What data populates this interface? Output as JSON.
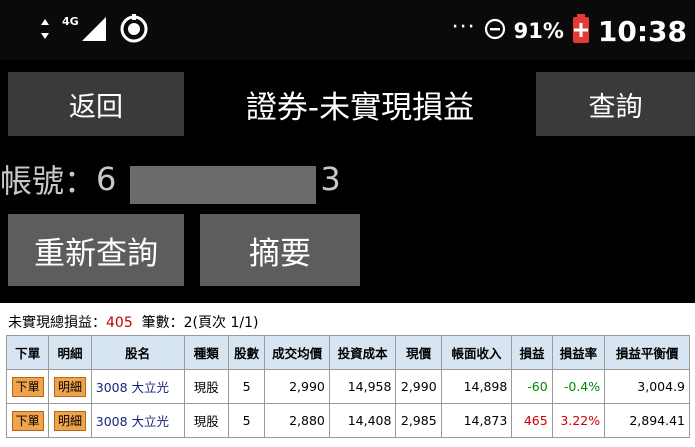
{
  "status_bar": {
    "network": "4G",
    "battery_percent": "91%",
    "time": "10:38",
    "dots": "···",
    "icons": [
      "data-arrows-icon",
      "signal-icon",
      "location-icon",
      "dnd-icon",
      "battery-icon"
    ]
  },
  "header": {
    "back_label": "返回",
    "title": "證券-未實現損益",
    "query_label": "查詢"
  },
  "account": {
    "label": "帳號：",
    "value_prefix": "6",
    "value_suffix": "3"
  },
  "actions": {
    "requery_label": "重新查詢",
    "summary_label": "摘要"
  },
  "summary": {
    "total_label": "未實現總損益：",
    "total_value": "405",
    "count_text": "  筆數：2(頁次 1/1)"
  },
  "table": {
    "headers": [
      "下單",
      "明細",
      "股名",
      "種類",
      "股數",
      "成交均價",
      "投資成本",
      "現價",
      "帳面收入",
      "損益",
      "損益率",
      "損益平衡價"
    ],
    "rows": [
      {
        "order": "下單",
        "detail": "明細",
        "stock": "3008 大立光",
        "kind": "現股",
        "shares": "5",
        "avg_price": "2,990",
        "cost": "14,958",
        "price": "2,990",
        "book_income": "14,898",
        "pnl": "-60",
        "pnl_rate": "-0.4%",
        "breakeven": "3,004.9"
      },
      {
        "order": "下單",
        "detail": "明細",
        "stock": "3008 大立光",
        "kind": "現股",
        "shares": "5",
        "avg_price": "2,880",
        "cost": "14,408",
        "price": "2,985",
        "book_income": "14,873",
        "pnl": "465",
        "pnl_rate": "3.22%",
        "breakeven": "2,894.41"
      }
    ]
  },
  "colors": {
    "background": "#000000",
    "button_dark": "#3a3a3a",
    "button_grey": "#5d5d5d",
    "header_cell": "#d7e4f2",
    "tag": "#f0a34a",
    "loss": "#008a00",
    "gain": "#d10000"
  }
}
